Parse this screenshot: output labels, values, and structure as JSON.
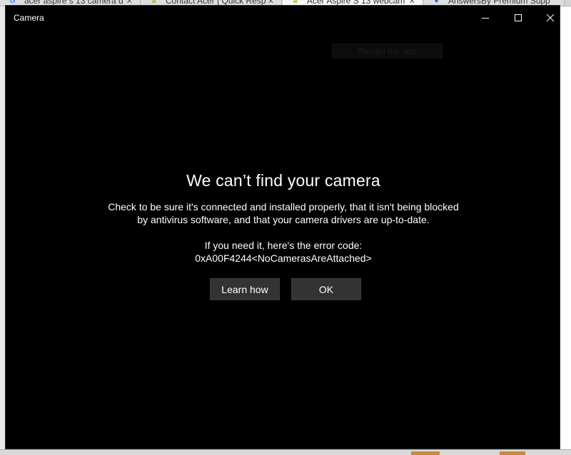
{
  "browser": {
    "tabs": [
      {
        "title": "acer aspire s 13 camera d",
        "icon": "google-icon",
        "active": false
      },
      {
        "title": "Contact Acer | Quick Resp",
        "icon": "acer-icon",
        "active": false
      },
      {
        "title": "Acer Aspire S 13 webcam",
        "icon": "acer-icon",
        "active": true
      },
      {
        "title": "AnswersBy Premium Supp",
        "icon": "answers-icon",
        "active": false
      }
    ],
    "close_glyph": "✕"
  },
  "window": {
    "title": "Camera",
    "ghost_button": "Restart the app"
  },
  "dialog": {
    "heading": "We can’t find your camera",
    "message_line1": "Check to be sure it's connected and installed properly, that it isn't being blocked",
    "message_line2": "by antivirus software, and that your camera drivers are up-to-date.",
    "error_label": "If you need it, here's the error code:",
    "error_code": "0xA00F4244<NoCamerasAreAttached>",
    "learn_button": "Learn how",
    "ok_button": "OK"
  },
  "colors": {
    "window_bg": "#000000",
    "button_bg": "#333333",
    "text": "#ffffff"
  }
}
